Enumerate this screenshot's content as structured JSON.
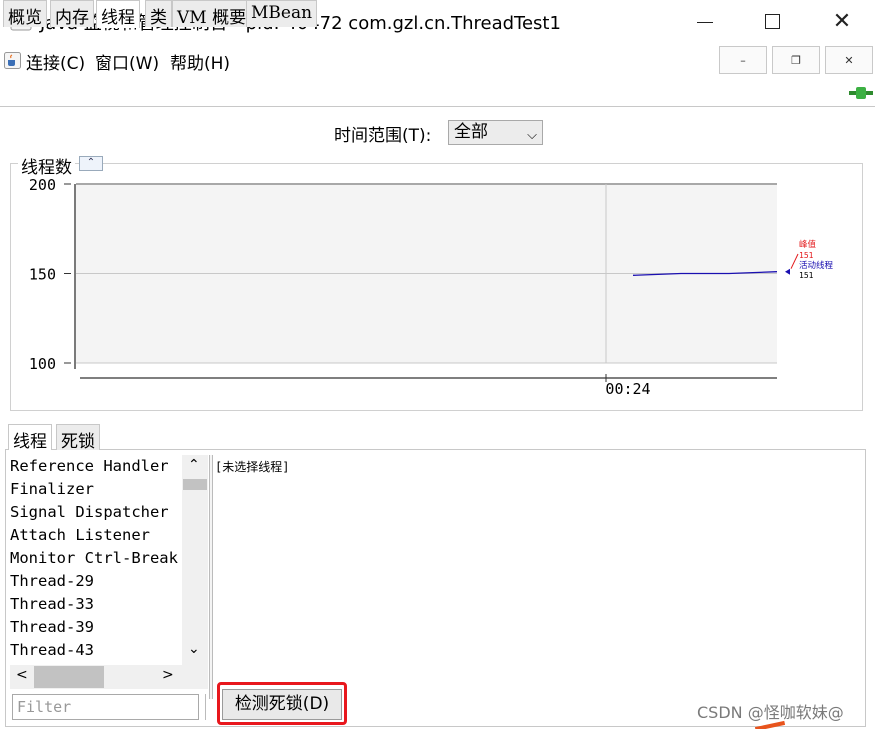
{
  "window": {
    "title": "Java 监视和管理控制台 - pid: 40472 com.gzl.cn.ThreadTest1",
    "icon": "java-cup-icon",
    "minimize_glyph": "—",
    "maximize_glyph": "☐",
    "close_glyph": "✕"
  },
  "menu": {
    "items": [
      "连接(C)",
      "窗口(W)",
      "帮助(H)"
    ],
    "mdi_minimize": "–",
    "mdi_restore": "❐",
    "mdi_close": "✕"
  },
  "tabs": [
    "概览",
    "内存",
    "线程",
    "类",
    "VM 概要",
    "MBean"
  ],
  "active_tab": "线程",
  "time_range": {
    "label": "时间范围(T):",
    "value": "全部"
  },
  "chart_panel": {
    "legend_title": "线程数"
  },
  "chart_data": {
    "type": "line",
    "title": "",
    "xlabel": "",
    "ylabel": "",
    "y_ticks": [
      100,
      150,
      200
    ],
    "ylim": [
      100,
      200
    ],
    "x_tick_labels": [
      "00:24"
    ],
    "grid": true,
    "series": [
      {
        "name": "活动线程",
        "color": "#1a0fb0",
        "x": [
          0,
          1,
          2,
          3
        ],
        "values": [
          149,
          150,
          150,
          151
        ]
      }
    ],
    "legend": [
      {
        "label": "峰值",
        "value": "151",
        "color": "#e31a1c"
      },
      {
        "label": "活动线程",
        "value": "151",
        "color": "#1a0fb0"
      }
    ]
  },
  "lower_tabs": [
    "线程",
    "死锁"
  ],
  "threads": [
    "Reference Handler",
    "Finalizer",
    "Signal Dispatcher",
    "Attach Listener",
    "Monitor Ctrl-Break",
    "Thread-29",
    "Thread-33",
    "Thread-39",
    "Thread-43"
  ],
  "detail_text": "[未选择线程]",
  "filter": {
    "placeholder": "Filter"
  },
  "deadlock_button": "检测死锁(D)",
  "watermark": "CSDN @怪咖软妹@"
}
